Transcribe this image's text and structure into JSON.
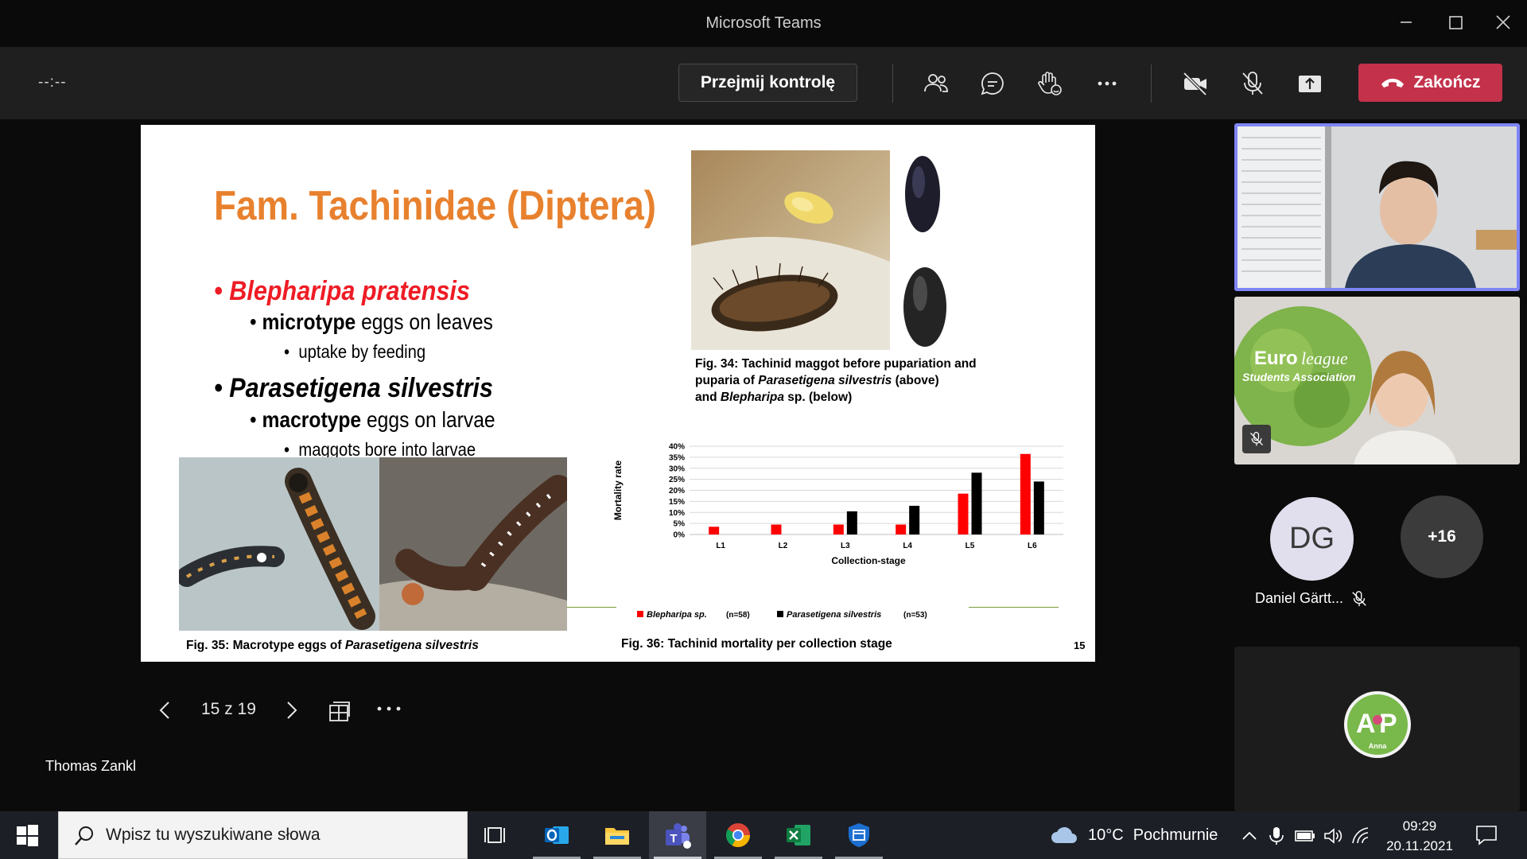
{
  "window": {
    "title": "Microsoft Teams"
  },
  "toolbar": {
    "timer": "--:--",
    "take_control_label": "Przejmij kontrolę",
    "end_call_label": "Zakończ",
    "icons": [
      "people-icon",
      "chat-icon",
      "reactions-icon",
      "more-icon",
      "camera-off-icon",
      "mic-off-icon",
      "share-icon"
    ]
  },
  "slide": {
    "title": "Fam. Tachinidae (Diptera)",
    "bullets": {
      "species1": "Blepharipa pratensis",
      "species1_type_bold": "microtype",
      "species1_type_rest": " eggs on leaves",
      "species1_detail": "uptake by feeding",
      "species2": "Parasetigena silvestris",
      "species2_type_bold": "macrotype",
      "species2_type_rest": " eggs on larvae",
      "species2_detail": "maggots bore into larvae"
    },
    "fig34": {
      "line1": "Fig. 34: Tachinid maggot before pupariation and",
      "line2_pre": "puparia of ",
      "line2_italic": "Parasetigena silvestris",
      "line2_post": " (above)",
      "line3_pre": "and ",
      "line3_italic": "Blepharipa",
      "line3_post": " sp. (below)"
    },
    "fig35": {
      "pre": "Fig. 35: Macrotype eggs of ",
      "italic": "Parasetigena silvestris"
    },
    "fig36": {
      "text": "Fig. 36: Tachinid mortality per collection stage"
    },
    "number": "15"
  },
  "chart_data": {
    "type": "bar",
    "ylabel": "Mortality rate",
    "xlabel": "Collection-stage",
    "categories": [
      "L1",
      "L2",
      "L3",
      "L4",
      "L5",
      "L6"
    ],
    "ylim": [
      0,
      40
    ],
    "yticks": [
      "0%",
      "5%",
      "10%",
      "15%",
      "20%",
      "25%",
      "30%",
      "35%",
      "40%"
    ],
    "grid": true,
    "legend_position": "bottom",
    "series": [
      {
        "name": "Blepharipa sp.",
        "count": "(n=58)",
        "color": "#ff0000",
        "values": [
          3.5,
          4.5,
          4.5,
          4.5,
          18.5,
          36.5
        ]
      },
      {
        "name": "Parasetigena silvestris",
        "count": "(n=53)",
        "color": "#000000",
        "values": [
          0,
          0,
          10.5,
          13,
          28,
          24
        ]
      }
    ]
  },
  "presenter_controls": {
    "counter": "15 z 19",
    "icons": [
      "chevron-left-icon",
      "chevron-right-icon",
      "slide-grid-icon",
      "more-icon"
    ]
  },
  "presenter_name": "Thomas Zankl",
  "participants": {
    "tile2_logo_text_a": "Euro",
    "tile2_logo_text_b": "league",
    "tile2_logo_text_c": "Students Association",
    "avatar_initials": "DG",
    "avatar_name": "Daniel Gärtt...",
    "overflow_count": "+16",
    "anna_logo": "Anna"
  },
  "taskbar": {
    "search_placeholder": "Wpisz tu wyszukiwane słowa",
    "apps": [
      "task-view-icon",
      "outlook-icon",
      "file-explorer-icon",
      "teams-icon",
      "chrome-icon",
      "excel-icon",
      "defender-icon"
    ],
    "weather_temp": "10°C",
    "weather_desc": "Pochmurnie",
    "time": "09:29",
    "date": "20.11.2021"
  },
  "colors": {
    "slide_title": "#e8812e",
    "species_red": "#ee1c25",
    "end_call": "#c4314b",
    "active_speaker_border": "#7f85f5"
  }
}
